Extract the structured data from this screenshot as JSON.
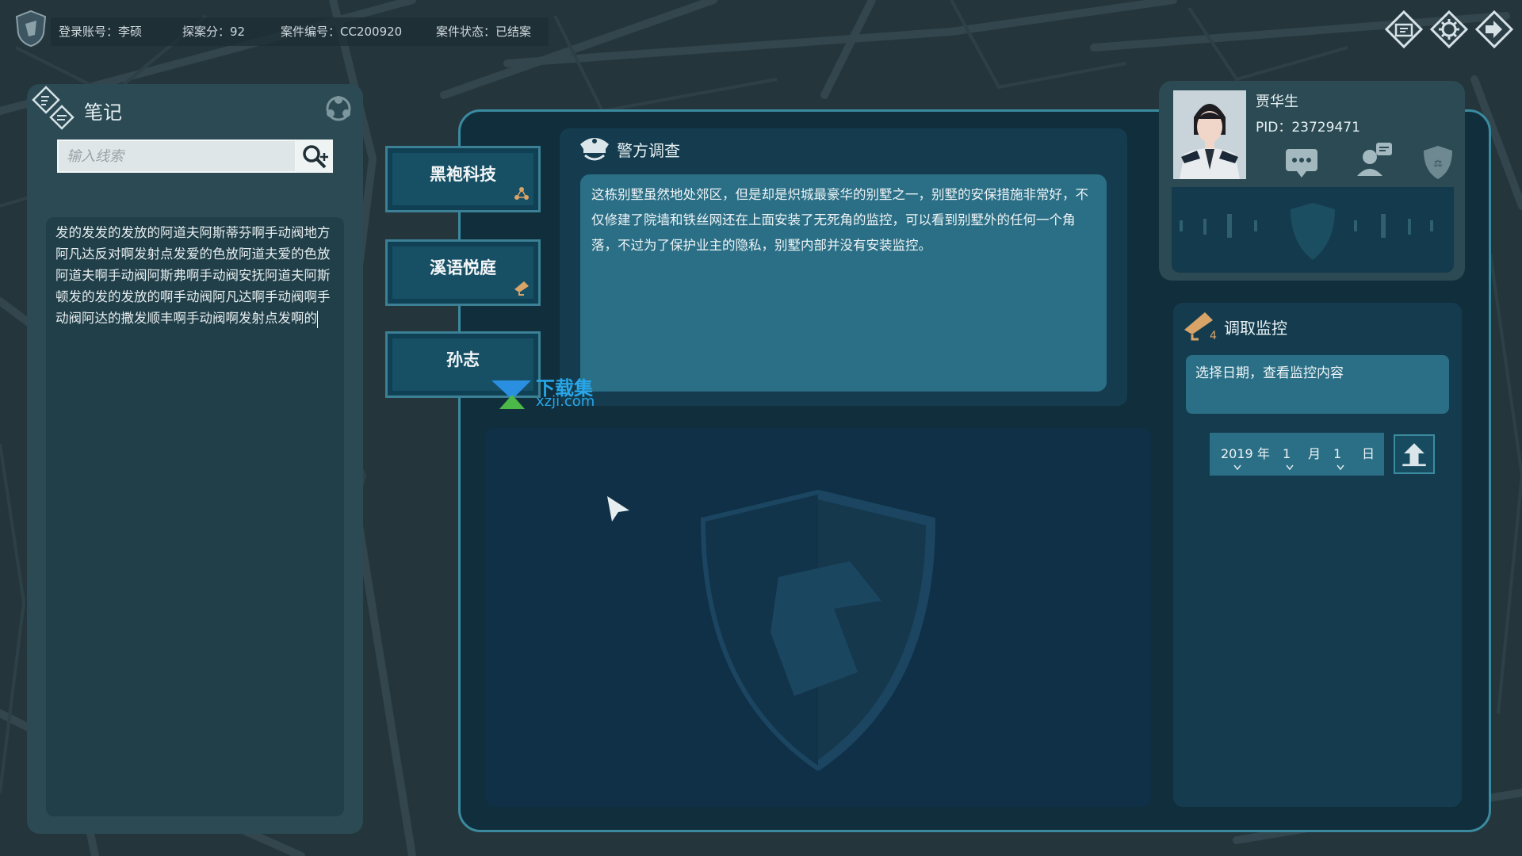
{
  "topbar": {
    "account": "登录账号：李硕",
    "score": "探案分：92",
    "case_id": "案件编号：CC200920",
    "case_status": "案件状态：已结案"
  },
  "notes": {
    "title": "笔记",
    "search_placeholder": "输入线索",
    "content": " 发的发发的发放的阿道夫阿斯蒂芬啊手动阀地方阿凡达反对啊发射点发爱的色放阿道夫爱的色放阿道夫啊手动阀阿斯弗啊手动阀安抚阿道夫阿斯顿发的发的发放的啊手动阀阿凡达啊手动阀啊手动阀阿达的撒发顺丰啊手动阀啊发射点发啊的"
  },
  "case_tabs": [
    {
      "label": "黑袍科技"
    },
    {
      "label": "溪语悦庭"
    },
    {
      "label": "孙志"
    }
  ],
  "police_investigation": {
    "title": "警方调查",
    "text": "这栋别墅虽然地处郊区，但是却是炽城最豪华的别墅之一，别墅的安保措施非常好，不仅修建了院墙和铁丝网还在上面安装了无死角的监控，可以看到别墅外的任何一个角落，不过为了保护业主的隐私，别墅内部并没有安装监控。"
  },
  "profile": {
    "name": "贾华生",
    "pid": "PID：23729471"
  },
  "surveillance": {
    "title": "调取监控",
    "description": "选择日期，查看监控内容",
    "year": "2019",
    "year_unit": "年",
    "month": "1",
    "month_unit": "月",
    "day": "1",
    "day_unit": "日"
  },
  "watermark": {
    "line1": "下载集",
    "line2": "xzji.com"
  }
}
